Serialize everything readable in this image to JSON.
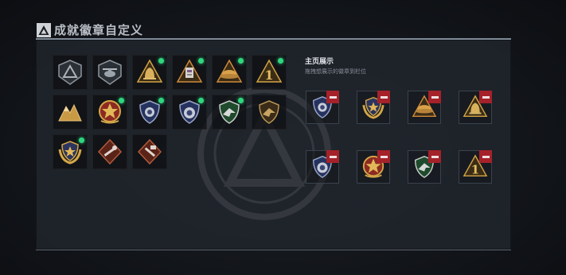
{
  "header": {
    "title": "成就徽章自定义",
    "icon": "delta-emblem-icon"
  },
  "showcase": {
    "title": "主页展示",
    "subtitle": "拖拽想展示的徽章到栏位"
  },
  "owned_badges": [
    {
      "name": "badge-delta-gray",
      "new": false
    },
    {
      "name": "badge-helicopter",
      "new": false
    },
    {
      "name": "badge-bell-gold",
      "new": true
    },
    {
      "name": "badge-card-orange",
      "new": true
    },
    {
      "name": "badge-hat-gold",
      "new": true
    },
    {
      "name": "badge-number-one",
      "new": true
    },
    {
      "name": "badge-mountains-gold",
      "new": false
    },
    {
      "name": "badge-star-medal",
      "new": true
    },
    {
      "name": "badge-police-shield",
      "new": true
    },
    {
      "name": "badge-police-shield-2",
      "new": true
    },
    {
      "name": "badge-green-eagle",
      "new": true
    },
    {
      "name": "badge-gold-eagle",
      "new": false
    },
    {
      "name": "badge-wreath-shield",
      "new": true
    },
    {
      "name": "badge-red-wrench",
      "new": false
    },
    {
      "name": "badge-red-hammer",
      "new": false
    }
  ],
  "displayed_badges": [
    {
      "name": "display-police-shield"
    },
    {
      "name": "display-wreath-shield"
    },
    {
      "name": "display-hat-gold"
    },
    {
      "name": "display-bell-gold"
    },
    {
      "name": "display-police-shield-2"
    },
    {
      "name": "display-star-medal"
    },
    {
      "name": "display-green-eagle"
    },
    {
      "name": "display-number-one"
    }
  ]
}
